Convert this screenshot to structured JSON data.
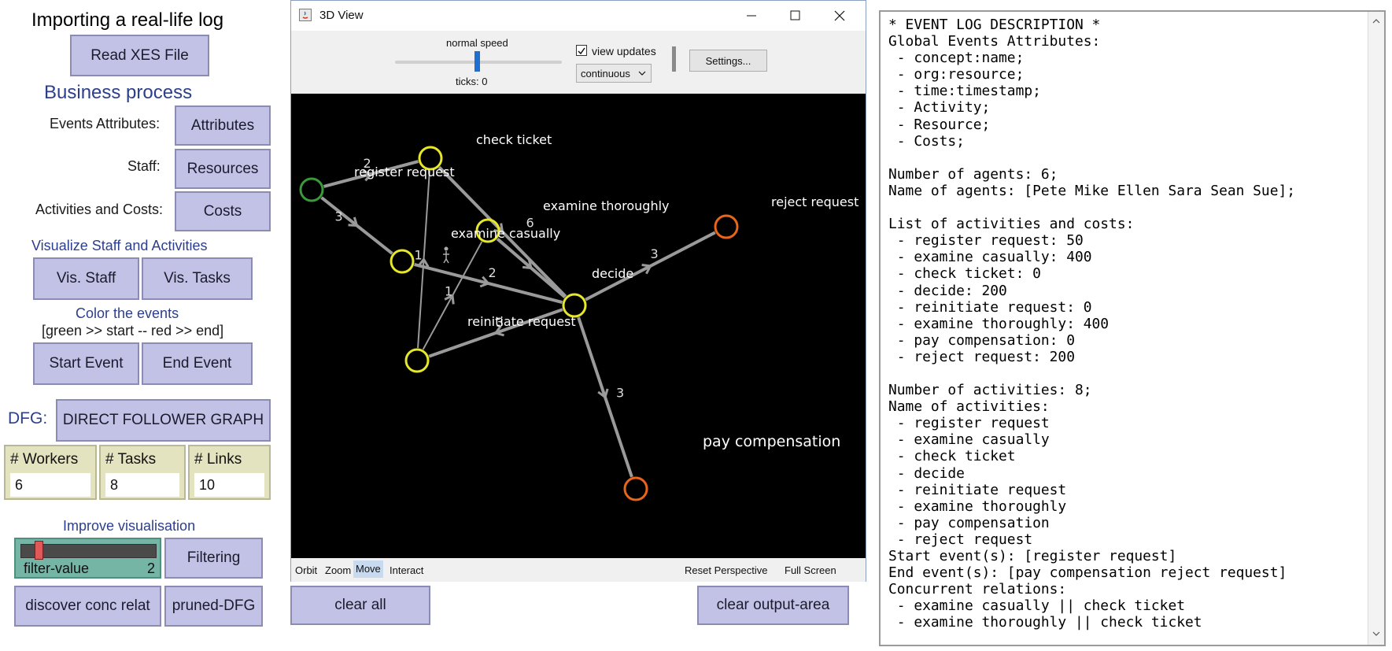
{
  "left_panel": {
    "heading": "Importing a real-life log",
    "read_xes_label": "Read XES File",
    "business_heading": "Business process",
    "events_attributes_label": "Events Attributes:",
    "attributes_btn": "Attributes",
    "staff_label": "Staff:",
    "resources_btn": "Resources",
    "activities_costs_label": "Activities and Costs:",
    "costs_btn": "Costs",
    "visualize_heading": "Visualize Staff and Activities",
    "vis_staff_btn": "Vis. Staff",
    "vis_tasks_btn": "Vis. Tasks",
    "color_heading": "Color the events",
    "color_sub": "[green >> start -- red >> end]",
    "start_event_btn": "Start Event",
    "end_event_btn": "End Event",
    "dfg_label": "DFG:",
    "dfg_btn": "DIRECT FOLLOWER GRAPH",
    "monitors": [
      {
        "label": "# Workers",
        "value": "6"
      },
      {
        "label": "# Tasks",
        "value": "8"
      },
      {
        "label": "# Links",
        "value": "10"
      }
    ],
    "improve_heading": "Improve visualisation",
    "slider": {
      "label": "filter-value",
      "value": "2",
      "fraction": 0.1
    },
    "filtering_btn": "Filtering",
    "discover_btn": "discover conc relat",
    "pruned_btn": "pruned-DFG",
    "clear_all_btn": "clear all",
    "clear_output_btn": "clear output-area"
  },
  "window3d": {
    "title": "3D View",
    "speed_label": "normal speed",
    "ticks_label": "ticks: 0",
    "view_updates_label": "view updates",
    "view_updates_checked": true,
    "update_mode": "continuous",
    "settings_btn": "Settings...",
    "footer": {
      "orbit": "Orbit",
      "zoom": "Zoom",
      "move": "Move",
      "interact": "Interact",
      "reset": "Reset Perspective",
      "full_screen": "Full Screen"
    }
  },
  "graph": {
    "colors": {
      "node_start": "#3a9a3a",
      "node_mid": "#e6e62a",
      "node_end": "#e8651a",
      "edge": "#9a9a9a",
      "background": "#000000",
      "label": "#ffffff"
    },
    "node_labels": {
      "check_ticket": "check  ticket",
      "register_request": "register  request",
      "examine_thoroughly": "examine  thoroughly",
      "reject_request": "reject  request",
      "examine_casually": "examine  casually",
      "decide": "decide",
      "reinitiate_request": "reinitiate  request",
      "pay_compensation": "pay  compensation"
    },
    "edge_labels": {
      "reg_check": "2",
      "reg_mid": "3",
      "casual_decide": "6",
      "check_reinit": "1",
      "mid_decide": "2",
      "reinit_casual": "1",
      "decide_reject": "3",
      "decide_reinit": "3",
      "decide_pay": "3"
    }
  },
  "output_area": {
    "text": "* EVENT LOG DESCRIPTION *\nGlobal Events Attributes:\n - concept:name;\n - org:resource;\n - time:timestamp;\n - Activity;\n - Resource;\n - Costs;\n\nNumber of agents: 6;\nName of agents: [Pete Mike Ellen Sara Sean Sue];\n\nList of activities and costs:\n - register request: 50\n - examine casually: 400\n - check ticket: 0\n - decide: 200\n - reinitiate request: 0\n - examine thoroughly: 400\n - pay compensation: 0\n - reject request: 200\n\nNumber of activities: 8;\nName of activities:\n - register request\n - examine casually\n - check ticket\n - decide\n - reinitiate request\n - examine thoroughly\n - pay compensation\n - reject request\nStart event(s): [register request]\nEnd event(s): [pay compensation reject request]\nConcurrent relations:\n - examine casually || check ticket\n - examine thoroughly || check ticket"
  }
}
